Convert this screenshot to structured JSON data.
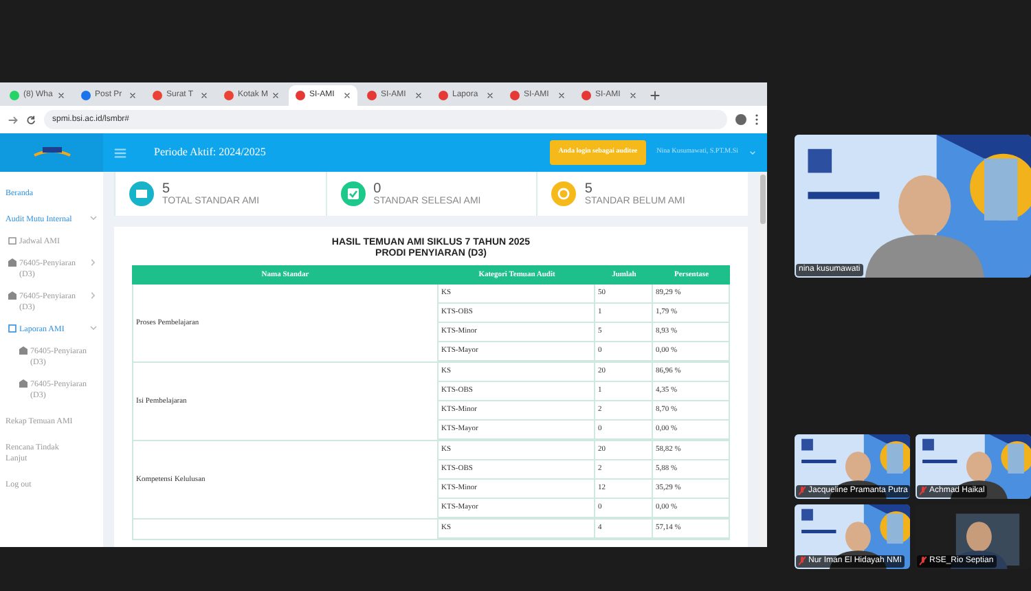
{
  "tabs": [
    {
      "label": "(8) Wha",
      "kind": "chat",
      "selected": false
    },
    {
      "label": "Post Pr",
      "kind": "meet",
      "selected": false
    },
    {
      "label": "Surat T",
      "kind": "mail",
      "selected": false
    },
    {
      "label": "Kotak M",
      "kind": "mail",
      "selected": false
    },
    {
      "label": "SI-AMI",
      "kind": "site",
      "selected": true
    },
    {
      "label": "SI-AMI",
      "kind": "site",
      "selected": false
    },
    {
      "label": "Lapora",
      "kind": "site",
      "selected": false
    },
    {
      "label": "SI-AMI",
      "kind": "site",
      "selected": false
    },
    {
      "label": "SI-AMI",
      "kind": "site",
      "selected": false
    }
  ],
  "address": "spmi.bsi.ac.id/lsmbr#",
  "header": {
    "period": "Periode Aktif: 2024/2025",
    "role_button": "Anda login sebagai auditee",
    "user": "Nina Kusumawati, S.PT.M.Si"
  },
  "sidebar": {
    "items": [
      {
        "label": "Beranda",
        "highlighted": true
      },
      {
        "label": "Audit Mutu Internal",
        "highlighted": true,
        "expanded": true,
        "children": [
          {
            "label": "Jadwal AMI",
            "kind": "calendar",
            "highlighted": false
          },
          {
            "label": "76405-Penyiaran (D3)",
            "kind": "building",
            "highlighted": false,
            "expanded": false
          },
          {
            "label": "76405-Penyiaran (D3)",
            "kind": "building",
            "highlighted": false,
            "expanded": false
          },
          {
            "label": "Laporan AMI",
            "kind": "report",
            "highlighted": true,
            "expanded": true,
            "children": [
              {
                "label": "76405-Penyiaran (D3)",
                "kind": "building",
                "highlighted": false
              },
              {
                "label": "76405-Penyiaran (D3)",
                "kind": "building",
                "highlighted": false
              }
            ]
          }
        ]
      },
      {
        "label": "Rekap Temuan AMI",
        "highlighted": false
      },
      {
        "label": "Rencana Tindak Lanjut",
        "highlighted": false
      },
      {
        "label": "Log out",
        "highlighted": false
      }
    ]
  },
  "cards": [
    {
      "value": "5",
      "label": "TOTAL STANDAR AMI",
      "kind": "list",
      "color": "#17b3c8"
    },
    {
      "value": "0",
      "label": "STANDAR SELESAI AMI",
      "kind": "check",
      "color": "#1cc88a"
    },
    {
      "value": "5",
      "label": "STANDAR BELUM AMI",
      "kind": "sync",
      "color": "#f6b91a"
    }
  ],
  "report": {
    "title": "HASIL TEMUAN AMI SIKLUS 7 TAHUN 2025",
    "subtitle": "PRODI PENYIARAN (D3)",
    "columns": [
      "Nama Standar",
      "Kategori Temuan Audit",
      "Jumlah",
      "Persentase"
    ],
    "groups": [
      {
        "name": "Proses Pembelajaran",
        "rows": [
          [
            "KS",
            "50",
            "89,29 %"
          ],
          [
            "KTS-OBS",
            "1",
            "1,79 %"
          ],
          [
            "KTS-Minor",
            "5",
            "8,93 %"
          ],
          [
            "KTS-Mayor",
            "0",
            "0,00 %"
          ]
        ]
      },
      {
        "name": "Isi Pembelajaran",
        "rows": [
          [
            "KS",
            "20",
            "86,96 %"
          ],
          [
            "KTS-OBS",
            "1",
            "4,35 %"
          ],
          [
            "KTS-Minor",
            "2",
            "8,70 %"
          ],
          [
            "KTS-Mayor",
            "0",
            "0,00 %"
          ]
        ]
      },
      {
        "name": "Kompetensi Kelulusan",
        "rows": [
          [
            "KS",
            "20",
            "58,82 %"
          ],
          [
            "KTS-OBS",
            "2",
            "5,88 %"
          ],
          [
            "KTS-Minor",
            "12",
            "35,29 %"
          ],
          [
            "KTS-Mayor",
            "0",
            "0,00 %"
          ]
        ]
      },
      {
        "rows": [
          [
            "KS",
            "4",
            "57,14 %"
          ]
        ]
      }
    ]
  },
  "participants": [
    {
      "name": "nina kusumawati",
      "muted": false,
      "kind": "picture"
    },
    {
      "name": "Jacqueline Pramanta Putra",
      "muted": true,
      "kind": "picture"
    },
    {
      "name": "Achmad Haikal",
      "muted": true,
      "kind": "picture"
    },
    {
      "name": "Nur Iman El Hidayah NMI",
      "muted": true,
      "kind": "picture"
    },
    {
      "name": "RSE_Rio Septian",
      "muted": true,
      "kind": "dark-picture"
    }
  ]
}
